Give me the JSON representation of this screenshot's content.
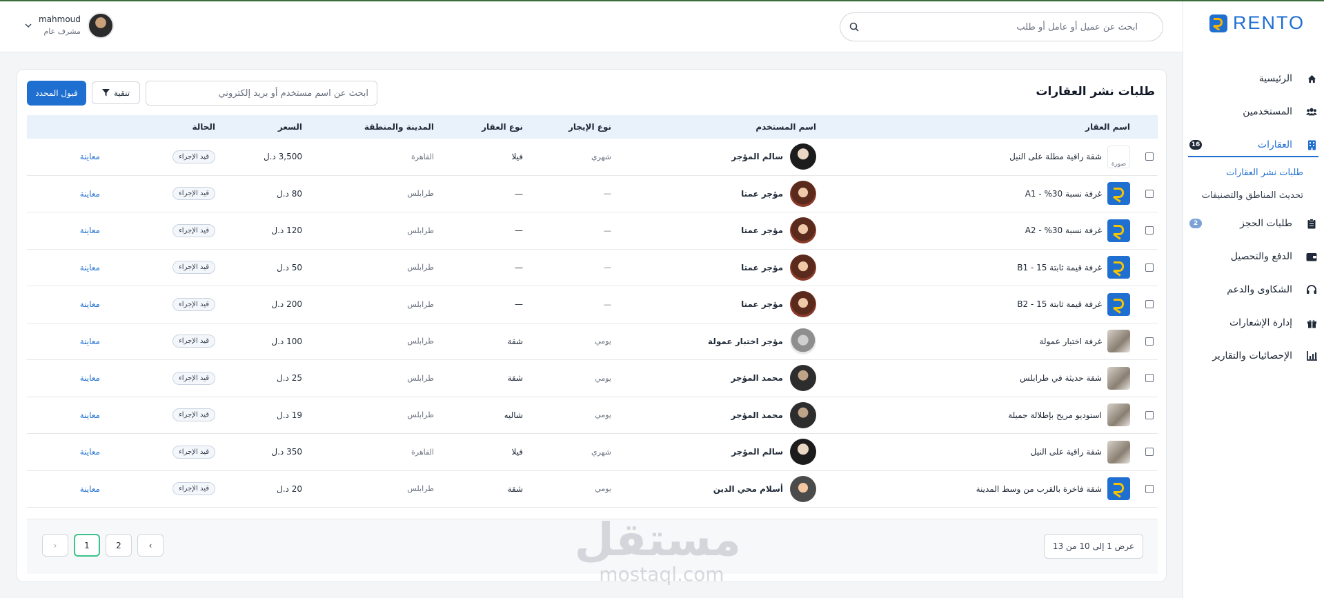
{
  "brand": {
    "name": "RENTO"
  },
  "header": {
    "search_placeholder": "ابحث عن عميل أو عامل أو طلب",
    "user_name": "mahmoud",
    "user_role": "مشرف عام"
  },
  "sidebar": {
    "items": [
      {
        "label": "الرئيسية",
        "icon": "home-icon"
      },
      {
        "label": "المستخدمين",
        "icon": "users-icon"
      },
      {
        "label": "العقارات",
        "icon": "building-icon",
        "badge": "16",
        "active": true
      },
      {
        "label": "طلبات الحجز",
        "icon": "clipboard-icon",
        "badge": "2"
      },
      {
        "label": "الدفع والتحصيل",
        "icon": "wallet-icon"
      },
      {
        "label": "الشكاوى والدعم",
        "icon": "headset-icon"
      },
      {
        "label": "إدارة الإشعارات",
        "icon": "gift-icon"
      },
      {
        "label": "الإحصائيات والتقارير",
        "icon": "chart-icon"
      }
    ],
    "sub_items": [
      {
        "label": "طلبات نشر العقارات",
        "active": true
      },
      {
        "label": "تحديث المناطق والتصنيفات"
      }
    ]
  },
  "page": {
    "title": "طلبات نشر العقارات",
    "filter_placeholder": "ابحث عن اسم مستخدم أو بريد إلكتروني",
    "filter_label": "تنقية",
    "accept_label": "قبول المحدد"
  },
  "table": {
    "columns": {
      "property": "اسم العقار",
      "user": "اسم المستخدم",
      "rent_type": "نوع الإيجار",
      "prop_type": "نوع العقار",
      "city": "المدينة والمنطقة",
      "price": "السعر",
      "status": "الحالة"
    },
    "rows": [
      {
        "property": "شقة راقية مطلة على النيل",
        "thumb": "broken",
        "thumb_alt": "صورة",
        "user": "سالم المؤجر",
        "avatar": "a1",
        "rent_type": "شهري",
        "prop_type": "فيلا",
        "city": "القاهرة",
        "price": "3,500 د.ل",
        "status": "قيد الإجراء",
        "action": "معاينة"
      },
      {
        "property": "غرفة نسبة 30% - A1",
        "thumb": "logo",
        "user": "مؤجر عمتا",
        "avatar": "a2",
        "rent_type": "—",
        "prop_type": "—",
        "city": "طرابلس",
        "price": "80 د.ل",
        "status": "قيد الإجراء",
        "action": "معاينة"
      },
      {
        "property": "غرفة نسبة 30% - A2",
        "thumb": "logo",
        "user": "مؤجر عمتا",
        "avatar": "a2",
        "rent_type": "—",
        "prop_type": "—",
        "city": "طرابلس",
        "price": "120 د.ل",
        "status": "قيد الإجراء",
        "action": "معاينة"
      },
      {
        "property": "غرفة قيمة ثابتة 15 - B1",
        "thumb": "logo",
        "user": "مؤجر عمتا",
        "avatar": "a2",
        "rent_type": "—",
        "prop_type": "—",
        "city": "طرابلس",
        "price": "50 د.ل",
        "status": "قيد الإجراء",
        "action": "معاينة"
      },
      {
        "property": "غرفة قيمة ثابتة 15 - B2",
        "thumb": "logo",
        "user": "مؤجر عمتا",
        "avatar": "a2",
        "rent_type": "—",
        "prop_type": "—",
        "city": "طرابلس",
        "price": "200 د.ل",
        "status": "قيد الإجراء",
        "action": "معاينة"
      },
      {
        "property": "غرفة اختبار عمولة",
        "thumb": "photo",
        "user": "مؤجر اختبار عمولة",
        "avatar": "a3",
        "rent_type": "يومي",
        "prop_type": "شقة",
        "city": "طرابلس",
        "price": "100 د.ل",
        "status": "قيد الإجراء",
        "action": "معاينة"
      },
      {
        "property": "شقة حديثة في طرابلس",
        "thumb": "photo",
        "user": "محمد المؤجر",
        "avatar": "a4",
        "rent_type": "يومي",
        "prop_type": "شقة",
        "city": "طرابلس",
        "price": "25 د.ل",
        "status": "قيد الإجراء",
        "action": "معاينة"
      },
      {
        "property": "استوديو مريح بإطلالة جميلة",
        "thumb": "photo",
        "user": "محمد المؤجر",
        "avatar": "a4",
        "rent_type": "يومي",
        "prop_type": "شاليه",
        "city": "طرابلس",
        "price": "19 د.ل",
        "status": "قيد الإجراء",
        "action": "معاينة"
      },
      {
        "property": "شقة راقية على النيل",
        "thumb": "photo",
        "user": "سالم المؤجر",
        "avatar": "a1",
        "rent_type": "شهري",
        "prop_type": "فيلا",
        "city": "القاهرة",
        "price": "350 د.ل",
        "status": "قيد الإجراء",
        "action": "معاينة"
      },
      {
        "property": "شقة فاخرة بالقرب من وسط المدينة",
        "thumb": "logo",
        "user": "أسلام محي الدين",
        "avatar": "a5",
        "rent_type": "يومي",
        "prop_type": "شقة",
        "city": "طرابلس",
        "price": "20 د.ل",
        "status": "قيد الإجراء",
        "action": "معاينة"
      }
    ]
  },
  "pagination": {
    "info": "عرض 1 إلى 10 من 13",
    "prev": "‹",
    "next": "›",
    "pages": [
      "1",
      "2"
    ],
    "current": "1"
  },
  "watermark": {
    "arabic": "مستقل",
    "latin": "mostaql.com"
  },
  "colors": {
    "accent": "#1f6fd1",
    "brand_yellow": "#f5b400",
    "active_page_border": "#3cc28a"
  }
}
